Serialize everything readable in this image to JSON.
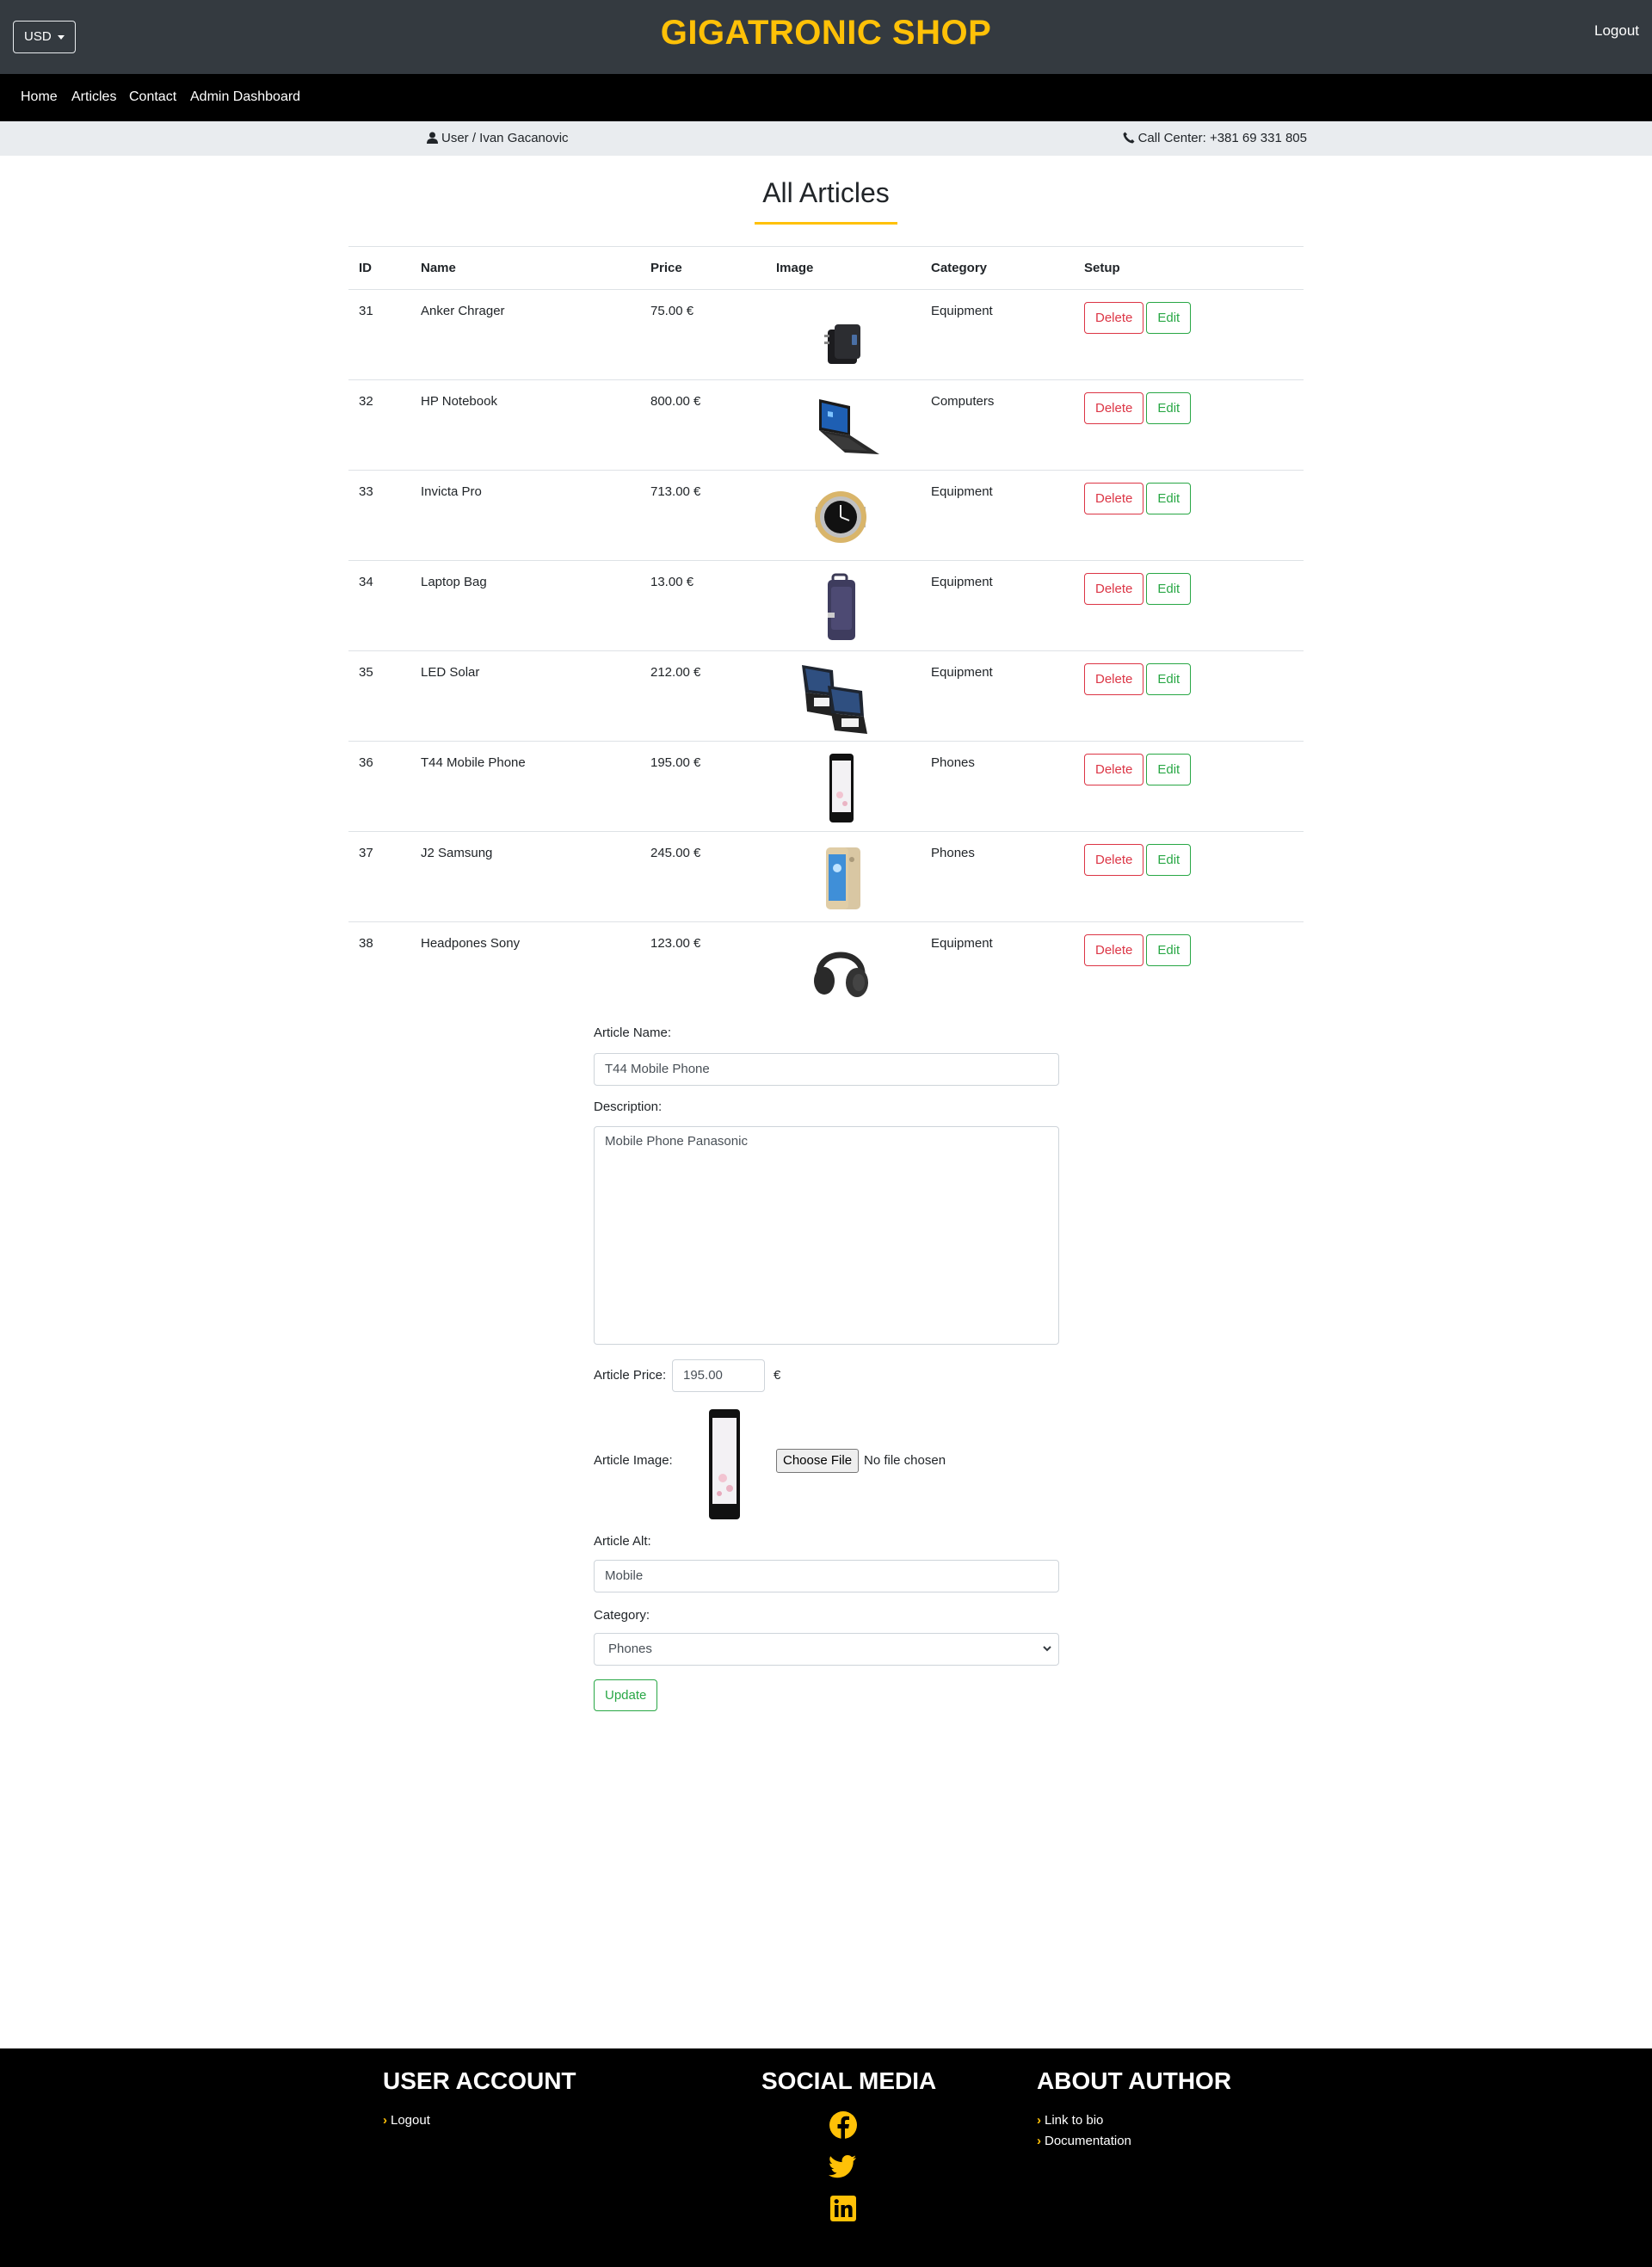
{
  "header": {
    "currency": "USD",
    "brand": "GIGATRONIC SHOP",
    "logout": "Logout"
  },
  "nav": {
    "items": [
      "Home",
      "Articles",
      "Contact",
      "Admin Dashboard"
    ]
  },
  "infobar": {
    "user": "User / Ivan Gacanovic",
    "call": "Call Center: +381 69 331 805"
  },
  "page": {
    "title": "All Articles"
  },
  "table": {
    "headers": [
      "ID",
      "Name",
      "Price",
      "Image",
      "Category",
      "Setup"
    ],
    "rows": [
      {
        "id": "31",
        "name": "Anker Chrager",
        "price": "75.00 €",
        "image": "charger-image",
        "category": "Equipment"
      },
      {
        "id": "32",
        "name": "HP Notebook",
        "price": "800.00 €",
        "image": "laptop-image",
        "category": "Computers"
      },
      {
        "id": "33",
        "name": "Invicta Pro",
        "price": "713.00 €",
        "image": "watch-image",
        "category": "Equipment"
      },
      {
        "id": "34",
        "name": "Laptop Bag",
        "price": "13.00 €",
        "image": "bag-image",
        "category": "Equipment"
      },
      {
        "id": "35",
        "name": "LED Solar",
        "price": "212.00 €",
        "image": "solar-light-image",
        "category": "Equipment"
      },
      {
        "id": "36",
        "name": "T44 Mobile Phone",
        "price": "195.00 €",
        "image": "phone-image",
        "category": "Phones"
      },
      {
        "id": "37",
        "name": "J2 Samsung",
        "price": "245.00 €",
        "image": "samsung-phone-image",
        "category": "Phones"
      },
      {
        "id": "38",
        "name": "Headpones Sony",
        "price": "123.00 €",
        "image": "headphones-image",
        "category": "Equipment"
      }
    ],
    "delete_label": "Delete",
    "edit_label": "Edit"
  },
  "form": {
    "name_label": "Article Name:",
    "name_value": "T44 Mobile Phone",
    "description_label": "Description:",
    "description_value": "Mobile Phone Panasonic",
    "price_label": "Article Price:",
    "price_value": "195.00",
    "currency_symbol": "€",
    "image_label": "Article Image:",
    "choose_file": "Choose File",
    "no_file": "No file chosen",
    "alt_label": "Article Alt:",
    "alt_value": "Mobile",
    "category_label": "Category:",
    "category_value": "Phones",
    "update_label": "Update"
  },
  "footer": {
    "user_account_title": "USER ACCOUNT",
    "user_account_links": [
      "Logout"
    ],
    "social_title": "SOCIAL MEDIA",
    "social_icons": [
      "facebook-icon",
      "twitter-icon",
      "linkedin-icon"
    ],
    "about_title": "ABOUT AUTHOR",
    "about_links": [
      "Link to bio",
      "Documentation"
    ]
  },
  "colors": {
    "accent": "#ffc107",
    "header_bg": "#343a40",
    "nav_bg": "#000000",
    "danger": "#dc3545",
    "success": "#28a745"
  }
}
